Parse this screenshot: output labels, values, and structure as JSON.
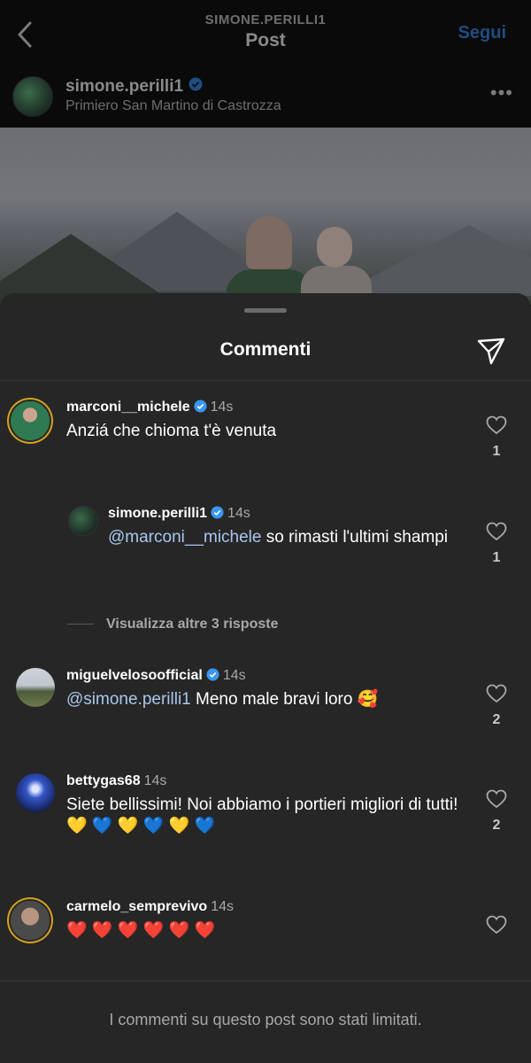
{
  "header": {
    "username_caps": "SIMONE.PERILLI1",
    "title": "Post",
    "follow_label": "Segui"
  },
  "post_user": {
    "name": "simone.perilli1",
    "location": "Primiero San Martino di Castrozza",
    "more": "•••"
  },
  "sheet": {
    "title": "Commenti"
  },
  "comments": [
    {
      "user": "marconi__michele",
      "verified": true,
      "time": "14s",
      "text": "Anziá che chioma t'è venuta",
      "likes": "1"
    },
    {
      "user": "simone.perilli1",
      "verified": true,
      "time": "14s",
      "mention": "@marconi__michele",
      "text": "so rimasti l'ultimi shampi",
      "likes": "1"
    },
    {
      "user": "miguelvelosoofficial",
      "verified": true,
      "time": "14s",
      "mention": "@simone.perilli1",
      "text": "Meno male bravi loro",
      "emoji": "🥰",
      "likes": "2"
    },
    {
      "user": "bettygas68",
      "verified": false,
      "time": "14s",
      "text": "Siete bellissimi! Noi abbiamo i portieri migliori di tutti!",
      "emoji": "💛 💙 💛 💙 💛 💙",
      "likes": "2"
    },
    {
      "user": "carmelo_semprevivo",
      "verified": false,
      "time": "14s",
      "emoji": "❤️ ❤️ ❤️ ❤️ ❤️ ❤️"
    }
  ],
  "view_replies": "Visualizza altre 3 risposte",
  "footer": "I commenti su questo post sono stati limitati.",
  "colors": {
    "sheet_bg": "#262626",
    "verified_blue": "#3897f0",
    "mention": "#a9c6ee",
    "story_ring": "#d4a21c"
  }
}
